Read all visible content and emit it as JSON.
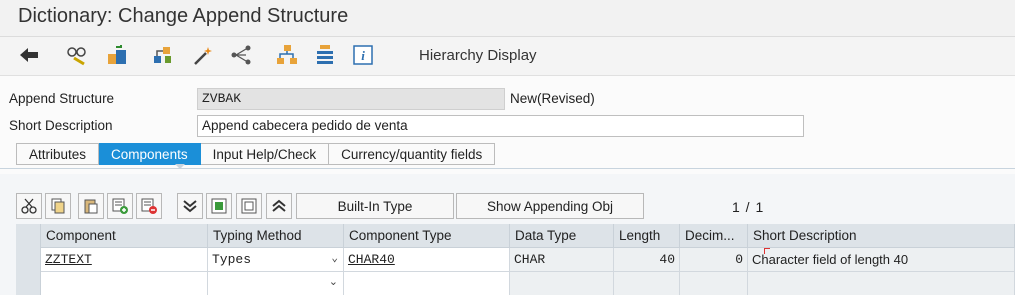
{
  "title": "Dictionary: Change Append Structure",
  "toolbar": {
    "hierarchy_label": "Hierarchy Display",
    "icons": [
      "back-arrow-icon",
      "display-change-icon",
      "activate-icon",
      "where-used-icon",
      "magic-wand-icon",
      "navigation-icon",
      "hierarchy-icon",
      "stack-icon",
      "info-icon"
    ]
  },
  "form": {
    "append_label": "Append Structure",
    "append_value": "ZVBAK",
    "status": "New(Revised)",
    "short_label": "Short Description",
    "short_value": "Append cabecera pedido de venta"
  },
  "tabs": [
    "Attributes",
    "Components",
    "Input Help/Check",
    "Currency/quantity fields"
  ],
  "active_tab": "Components",
  "table_toolbar": {
    "builtin_label": "Built-In Type",
    "show_label": "Show Appending Obj",
    "page": "1 / 1"
  },
  "grid": {
    "headers": [
      "Component",
      "Typing Method",
      "Component Type",
      "Data Type",
      "Length",
      "Decim...",
      "Short Description"
    ],
    "rows": [
      {
        "component": "ZZTEXT",
        "typing": "Types",
        "comp_type": "CHAR40",
        "data_type": "CHAR",
        "length": "40",
        "decimals": "0",
        "desc": "Character field of length 40"
      }
    ]
  },
  "colors": {
    "accent": "#1b8fd8",
    "header_bg": "#dde3e8"
  }
}
